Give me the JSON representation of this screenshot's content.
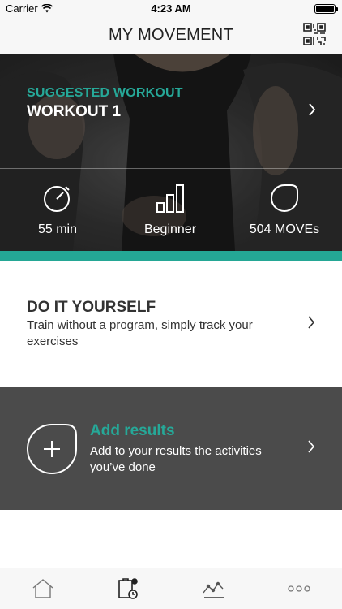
{
  "status_bar": {
    "carrier": "Carrier",
    "time": "4:23 AM"
  },
  "nav": {
    "title": "MY MOVEMENT",
    "qr_icon": "qr-code-icon"
  },
  "suggested": {
    "eyebrow": "SUGGESTED WORKOUT",
    "title": "WORKOUT 1",
    "stats": [
      {
        "icon": "stopwatch-icon",
        "label": "55 min"
      },
      {
        "icon": "level-bars-icon",
        "label": "Beginner"
      },
      {
        "icon": "moves-badge-icon",
        "label": "504 MOVEs"
      }
    ]
  },
  "diy": {
    "title": "DO IT YOURSELF",
    "description": "Train without a program, simply track your exercises"
  },
  "results": {
    "title": "Add results",
    "description": "Add to your results the activities you’ve done"
  },
  "tabs": [
    {
      "icon": "home-icon"
    },
    {
      "icon": "workout-plan-icon"
    },
    {
      "icon": "stats-chart-icon"
    },
    {
      "icon": "more-icon"
    }
  ],
  "colors": {
    "accent": "#24a795",
    "dark_card": "#4b4b4b",
    "bar_background": "#f7f7f7"
  }
}
